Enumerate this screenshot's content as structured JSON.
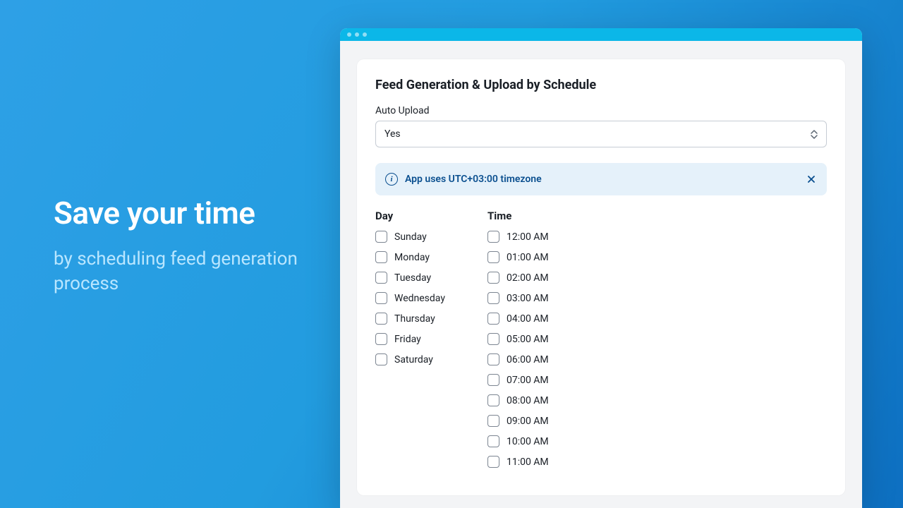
{
  "marketing": {
    "headline": "Save your time",
    "sub": "by scheduling feed generation process"
  },
  "card": {
    "title": "Feed Generation & Upload by Schedule",
    "auto_upload_label": "Auto Upload",
    "auto_upload_value": "Yes",
    "banner_text": "App uses UTC+03:00 timezone",
    "day_header": "Day",
    "time_header": "Time",
    "days": [
      "Sunday",
      "Monday",
      "Tuesday",
      "Wednesday",
      "Thursday",
      "Friday",
      "Saturday"
    ],
    "times": [
      "12:00 AM",
      "01:00 AM",
      "02:00 AM",
      "03:00 AM",
      "04:00 AM",
      "05:00 AM",
      "06:00 AM",
      "07:00 AM",
      "08:00 AM",
      "09:00 AM",
      "10:00 AM",
      "11:00 AM"
    ]
  }
}
